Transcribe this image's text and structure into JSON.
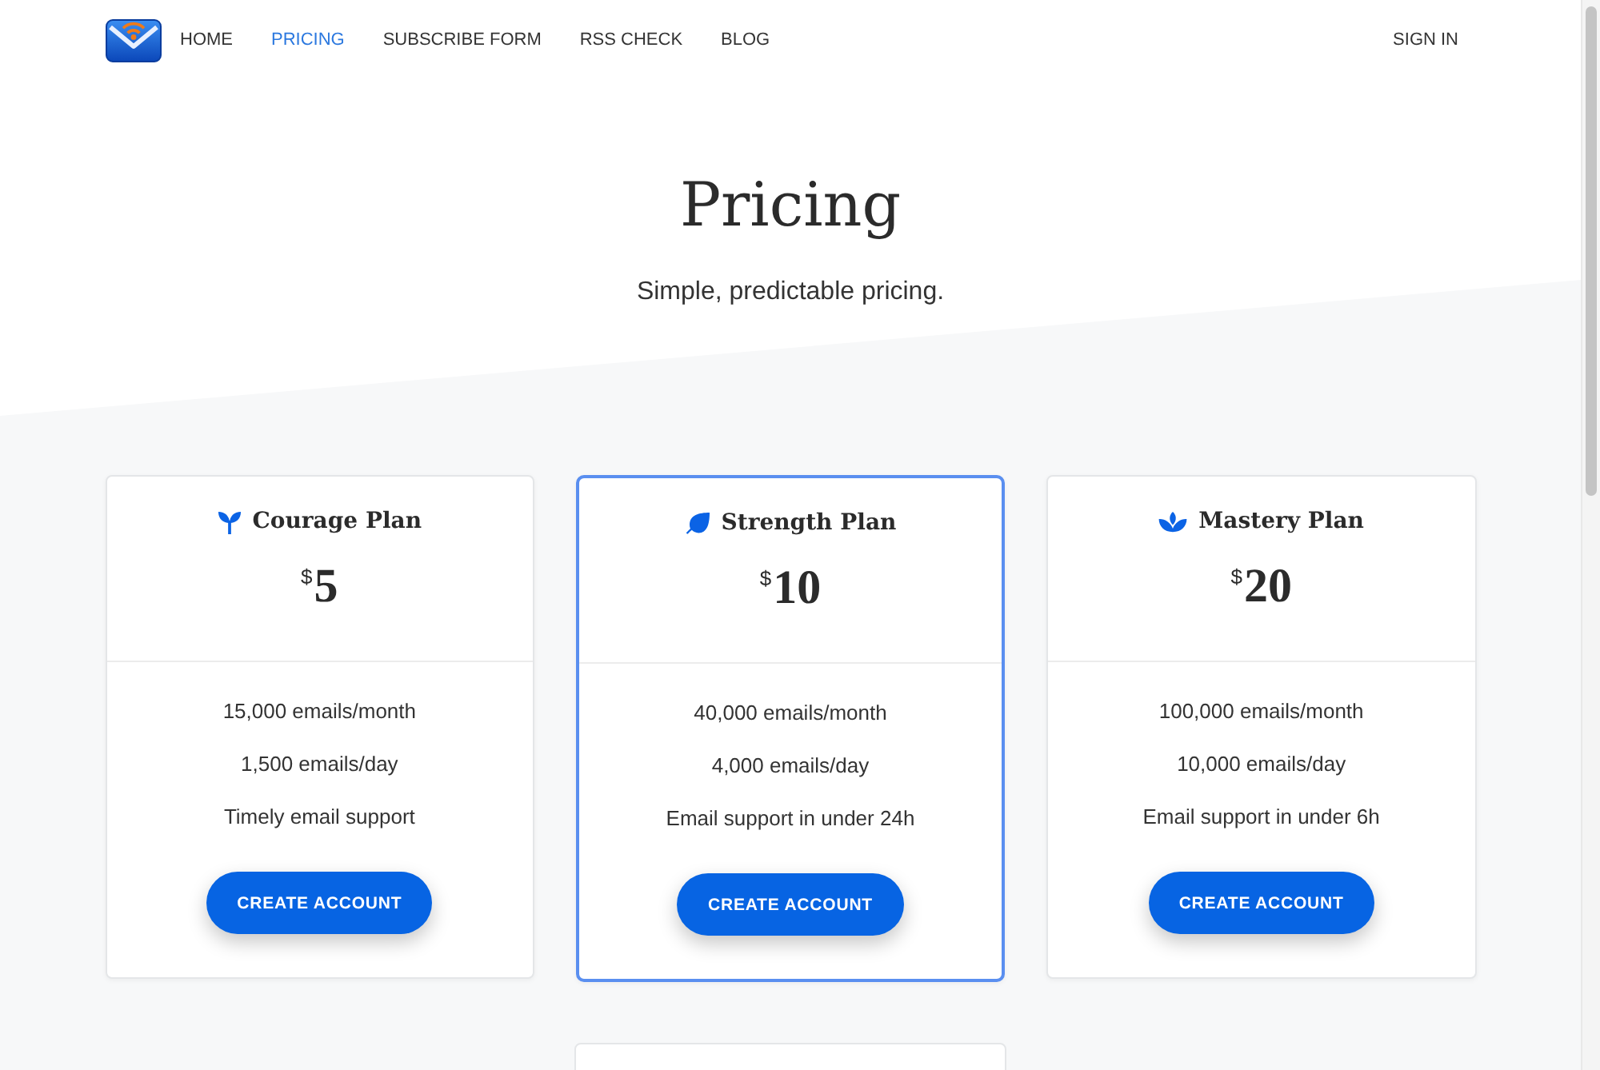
{
  "nav": {
    "links": [
      {
        "label": "HOME",
        "selected": false
      },
      {
        "label": "PRICING",
        "selected": true
      },
      {
        "label": "SUBSCRIBE FORM",
        "selected": false
      },
      {
        "label": "RSS CHECK",
        "selected": false
      },
      {
        "label": "BLOG",
        "selected": false
      }
    ],
    "sign_in": "SIGN IN"
  },
  "hero": {
    "title": "Pricing",
    "subtitle": "Simple, predictable pricing."
  },
  "plans": [
    {
      "name": "Courage Plan",
      "highlighted": false,
      "currency": "$",
      "amount": "5",
      "features": [
        "15,000 emails/month",
        "1,500 emails/day",
        "Timely email support"
      ],
      "button": "CREATE ACCOUNT"
    },
    {
      "name": "Strength Plan",
      "highlighted": true,
      "currency": "$",
      "amount": "10",
      "features": [
        "40,000 emails/month",
        "4,000 emails/day",
        "Email support in under 24h"
      ],
      "button": "CREATE ACCOUNT"
    },
    {
      "name": "Mastery Plan",
      "highlighted": false,
      "currency": "$",
      "amount": "20",
      "features": [
        "100,000 emails/month",
        "10,000 emails/day",
        "Email support in under 6h"
      ],
      "button": "CREATE ACCOUNT"
    }
  ]
}
